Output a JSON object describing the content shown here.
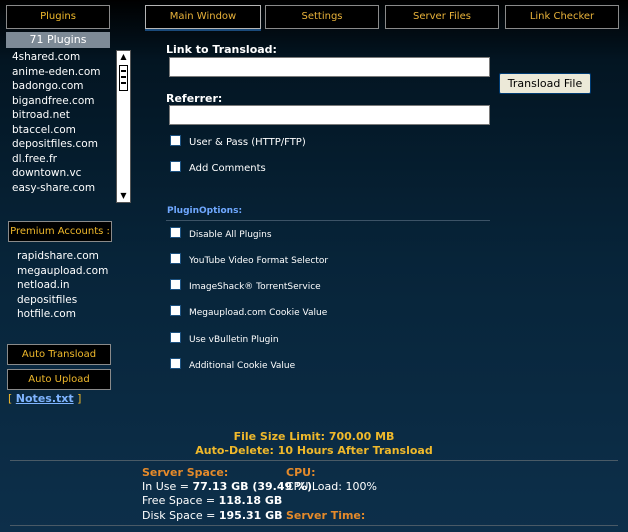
{
  "sidebar": {
    "plugins_button": "Plugins",
    "plugins_count": "71 Plugins",
    "plugins": [
      "4shared.com",
      "anime-eden.com",
      "badongo.com",
      "bigandfree.com",
      "bitroad.net",
      "btaccel.com",
      "depositfiles.com",
      "dl.free.fr",
      "downtown.vc",
      "easy-share.com"
    ],
    "premium_button": "Premium Accounts :",
    "accounts": [
      "rapidshare.com",
      "megaupload.com",
      "netload.in",
      "depositfiles",
      "hotfile.com"
    ],
    "auto_transload": "Auto Transload",
    "auto_upload": "Auto Upload",
    "notes_open": "[",
    "notes_link": "Notes.txt",
    "notes_close": "]"
  },
  "tabs": [
    "Main Window",
    "Settings",
    "Server Files",
    "Link Checker"
  ],
  "form": {
    "link_label": "Link to Transload:",
    "link_value": "",
    "referrer_label": "Referrer:",
    "referrer_value": "",
    "transload_button": "Transload File",
    "user_pass": "User & Pass (HTTP/FTP)",
    "add_comments": "Add Comments",
    "plugin_options_title": "PluginOptions:",
    "options": [
      "Disable All Plugins",
      "YouTube Video Format Selector",
      "ImageShack® TorrentService",
      "Megaupload.com Cookie Value",
      "Use vBulletin Plugin",
      "Additional Cookie Value"
    ]
  },
  "limits": {
    "file_size_label": "File Size Limit:",
    "file_size_value": "700.00 MB",
    "auto_delete_label": "Auto-Delete:",
    "auto_delete_value": "10 Hours After Transload"
  },
  "server": {
    "space_title": "Server Space:",
    "in_use_label": "In Use =",
    "in_use_value": "77.13 GB (39.49 %)",
    "free_label": "Free Space =",
    "free_value": "118.18 GB",
    "disk_label": "Disk Space =",
    "disk_value": "195.31 GB",
    "cpu_title": "CPU:",
    "cpu_load": "CPU Load: 100%",
    "time_title": "Server Time:"
  },
  "colors": {
    "accent": "#f0b92b",
    "orange": "#e58a2a",
    "link": "#7fb4ff"
  }
}
